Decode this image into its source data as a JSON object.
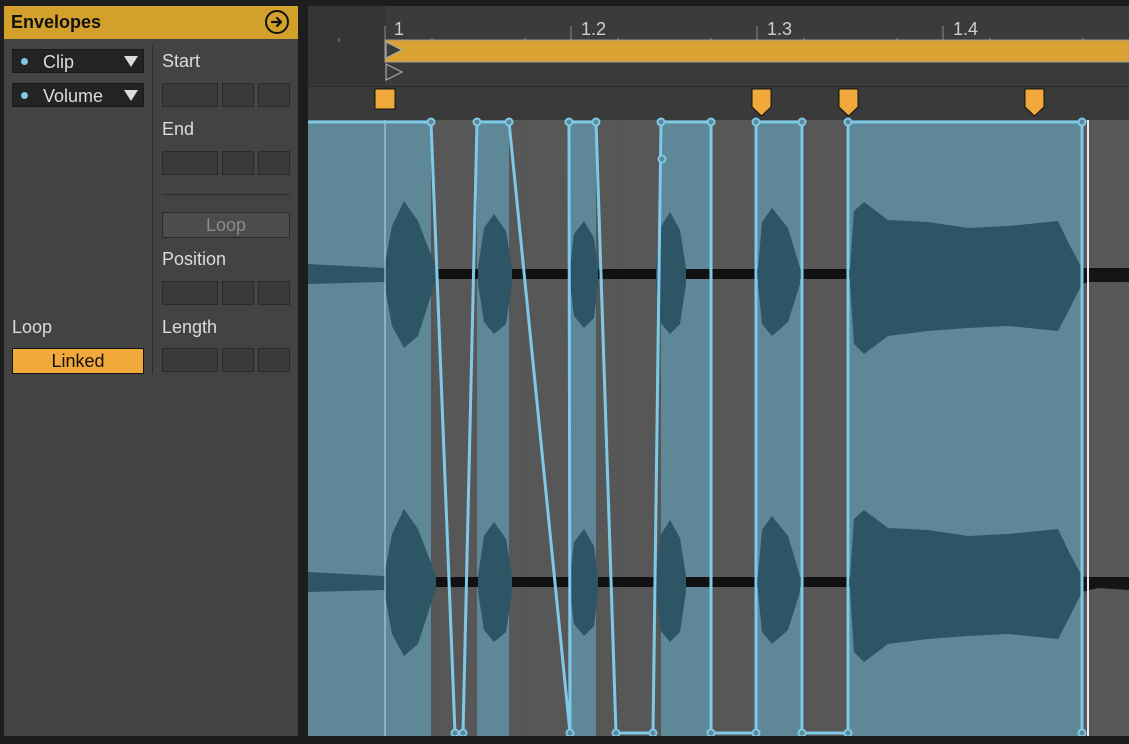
{
  "envelopes": {
    "title": "Envelopes",
    "clip_chooser": "Clip",
    "control_chooser": "Volume"
  },
  "params": {
    "start_label": "Start",
    "end_label": "End",
    "loop_button": "Loop",
    "position_label": "Position",
    "length_label": "Length"
  },
  "loop": {
    "label": "Loop",
    "linked_button": "Linked"
  },
  "ruler": {
    "labels": [
      "1",
      "1.2",
      "1.3",
      "1.4"
    ]
  },
  "colors": {
    "accent": "#f0a93a",
    "envelope": "#7ec8e8",
    "waveform": "#2e5565",
    "clip_region": "#5e8797",
    "background": "#434343"
  }
}
